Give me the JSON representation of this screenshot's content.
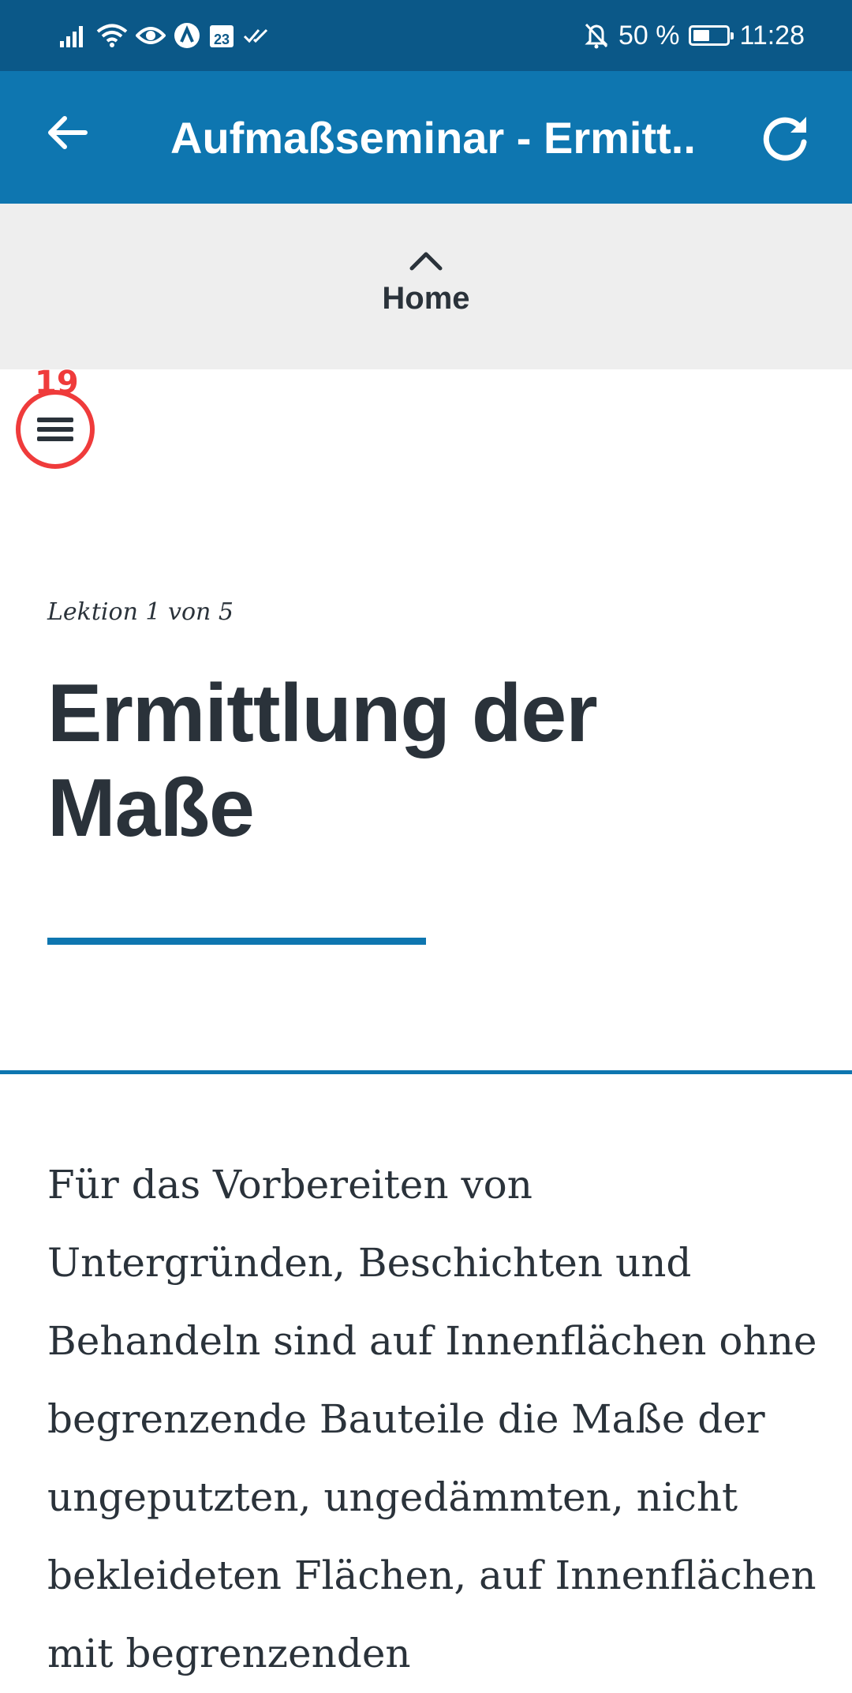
{
  "status_bar": {
    "battery_percent": "50 %",
    "battery_level": 0.5,
    "time": "11:28",
    "calendar_day": "23",
    "left_icons": [
      "signal-icon",
      "wifi-icon",
      "eye-icon",
      "app-a-icon",
      "calendar-icon",
      "double-check-icon"
    ],
    "right_icons": [
      "bell-off-icon",
      "battery-icon"
    ]
  },
  "app_bar": {
    "title": "Aufmaßseminar - Ermitt..",
    "back_icon": "arrow-left-icon",
    "refresh_icon": "refresh-icon"
  },
  "home_nav": {
    "label": "Home",
    "icon": "chevron-up-icon"
  },
  "menu": {
    "icon": "hamburger-menu-icon",
    "marker_number": "19"
  },
  "lesson": {
    "counter": "Lektion 1 von 5",
    "title": "Ermittlung der Maße",
    "body": "Für das Vorbereiten von Untergründen, Beschichten und Behandeln sind auf Innenflächen ohne begrenzende Bauteile die Maße der ungeputzten, ungedämmten, nicht bekleideten Flächen, auf Innenflächen mit begrenzenden"
  },
  "colors": {
    "status_bar": "#0b5888",
    "app_bar": "#0e76b0",
    "accent": "#0e76b0",
    "home_band": "#eeeeee",
    "marker": "#ef3b3b",
    "text": "#2a323a"
  }
}
